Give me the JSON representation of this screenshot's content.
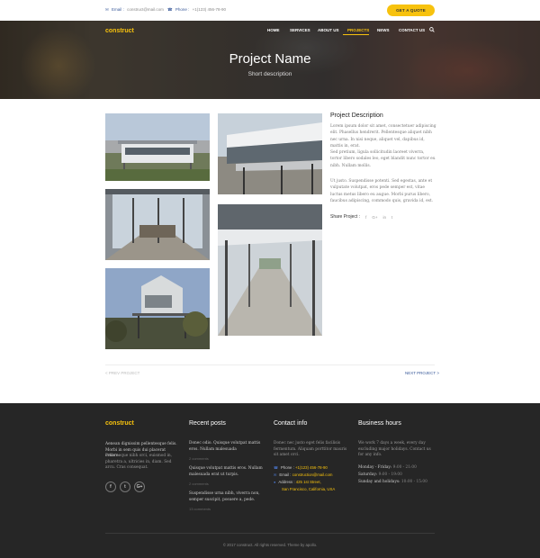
{
  "topbar": {
    "email_label": "Email :",
    "email_value": "construct@mail.com",
    "phone_label": "Phone :",
    "phone_value": "+1(123) 456-78-90",
    "quote_button": "GET A QUOTE"
  },
  "header": {
    "logo": "construct",
    "nav": [
      "HOME",
      "SERVICES",
      "ABOUT US",
      "PROJECTS",
      "NEWS",
      "CONTACT US"
    ],
    "active_nav": "PROJECTS",
    "title": "Project Name",
    "subtitle": "Short description"
  },
  "project": {
    "desc_title": "Project Description",
    "desc_p1": "Lorem ipsum dolor sit amet, consectetuer adipiscing elit. Phasellus hendrerit. Pellentesque aliquet nibh nec urna. In nisi neque, aliquet vel, dapibus id, mattis in, erat.",
    "desc_p2": "Sed pretium, ligula sollicitudin laoreet viverra, tortor libero sodales leo, eget blandit nunc tortor eu nibh. Nullam mollis.",
    "desc_p3": "Ut justo. Suspendisse potenti. Sed egestas, ante et vulputate volutpat, eros pede semper est, vitae luctus metus libero eu augue. Morbi purus libero, faucibus adipiscing, commodo quis, gravida id, est.",
    "share_label": "Share Project :",
    "share_icons": [
      "f",
      "G+",
      "in",
      "t"
    ],
    "prev_label": "< PREV PROJECT",
    "next_label": "NEXT PROJECT >"
  },
  "footer": {
    "col1": {
      "logo": "construct",
      "text_light": "Aenean dignissim pellentesque felis. Morbi in sem quis dui placerat ornare.",
      "text": "Pelle neque nibh orci, euismod in, pharetra a, ultricies in, diam. Sed arcu. Cras consequat.",
      "social": [
        "f",
        "t",
        "G+"
      ]
    },
    "col2": {
      "heading": "Recent posts",
      "posts": [
        {
          "title": "Donec odio. Quisque volutpat mattis eros. Nullam malesuada",
          "comments": "2 comments"
        },
        {
          "title": "Quisque volutpat mattis eros. Nullam malesuada erat ut turpis.",
          "comments": "2 comments"
        },
        {
          "title": "Suspendisse urna nibh, viverra non, semper suscipit, posuere a, pede.",
          "comments": "13 comments"
        }
      ]
    },
    "col3": {
      "heading": "Contact info",
      "text": "Donec nec justo eget felis facilisis fermentum. Aliquam porttitor mauris sit amet orci.",
      "phone_label": "Phone :",
      "phone_value": "+1(123) 456-78-90",
      "email_label": "Email :",
      "email_value": "construction@mail.com",
      "address_label": "Address :",
      "address_line1": "425 1st Street,",
      "address_line2": "San Francisco, California, USA"
    },
    "col4": {
      "heading": "Business hours",
      "text": "We work 7 days a week, every day excluding major holidays. Contact us for any info.",
      "hours": [
        {
          "day": "Monday - Friday:",
          "time": "9:00 - 21:00"
        },
        {
          "day": "Saturday:",
          "time": "9:00 - 19:00"
        },
        {
          "day": "Sunday and holidays:",
          "time": "10:00 - 15:00"
        }
      ]
    },
    "copyright": "© 2017 construct. All rights reserved. Theme by apollo."
  },
  "colors": {
    "accent": "#f7c20e",
    "link": "#3a5a9a",
    "footer_bg": "#262626"
  }
}
